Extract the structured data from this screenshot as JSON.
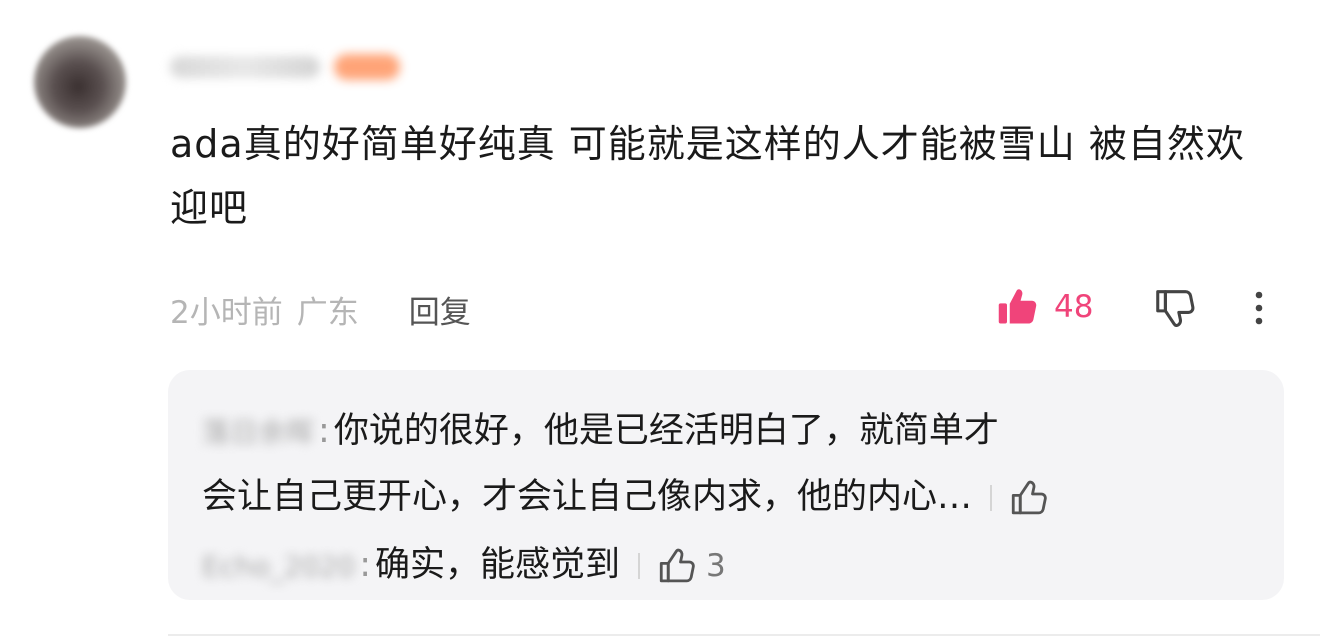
{
  "comment": {
    "username": "xuaaahu3",
    "text": "ada真的好简单好纯真 可能就是这样的人才能被雪山 被自然欢迎吧",
    "time": "2小时前",
    "location": "广东",
    "reply_label": "回复",
    "like_count": "48",
    "accent_color": "#f0447a"
  },
  "replies": [
    {
      "username": "落日余晖",
      "colon": ":",
      "text": "你说的很好，他是已经活明白了，就简单才",
      "text_line2": "会让自己更开心，才会让自己像内求，他的内心…"
    },
    {
      "username": "Echo_2020",
      "colon": ":",
      "text": "确实，能感觉到",
      "like_count": "3"
    }
  ],
  "icons": {
    "like": "thumbs-up-filled-icon",
    "dislike": "thumbs-down-outline-icon",
    "more": "vertical-ellipsis-icon",
    "reply_like": "thumbs-up-outline-icon"
  }
}
